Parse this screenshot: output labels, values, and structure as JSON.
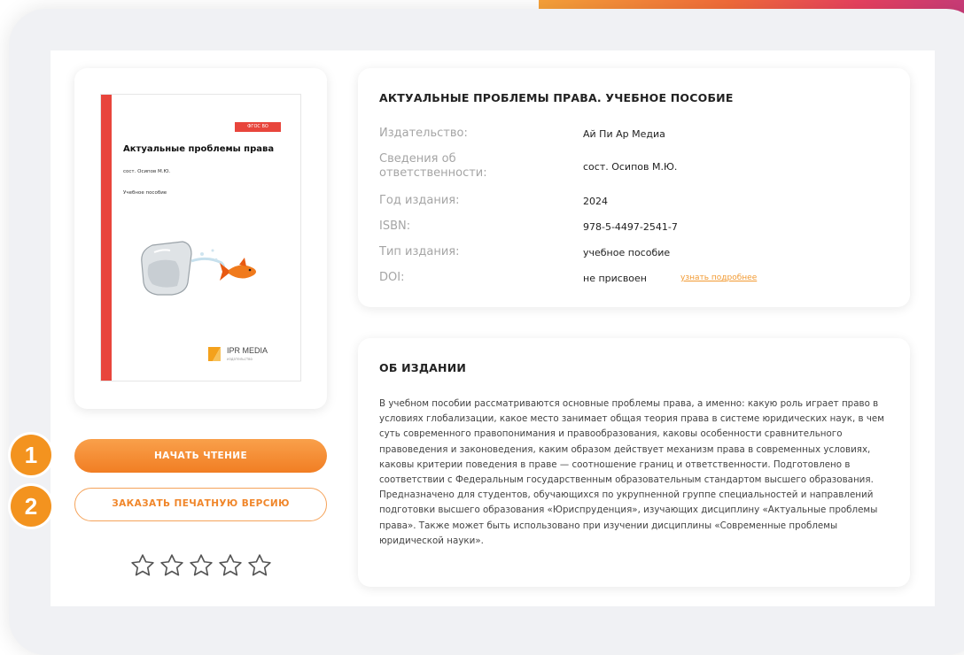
{
  "cover": {
    "badge": "ФГОС ВО",
    "title": "Актуальные проблемы права",
    "author": "сост. Осипов М.Ю.",
    "type": "Учебное пособие",
    "logo_text": "IPR MEDIA",
    "logo_sub": "издательство"
  },
  "buttons": {
    "start_reading": "НАЧАТЬ ЧТЕНИЕ",
    "order_print": "ЗАКАЗАТЬ ПЕЧАТНУЮ ВЕРСИЮ"
  },
  "markers": [
    "1",
    "2"
  ],
  "rating": {
    "stars": 5,
    "filled": 0
  },
  "info": {
    "title": "АКТУАЛЬНЫЕ ПРОБЛЕМЫ ПРАВА. УЧЕБНОЕ ПОСОБИЕ",
    "rows": [
      {
        "label": "Издательство:",
        "value": "Ай Пи Ар Медиа"
      },
      {
        "label": "Сведения об ответственности:",
        "value": "сост. Осипов М.Ю."
      },
      {
        "label": "Год издания:",
        "value": "2024"
      },
      {
        "label": "ISBN:",
        "value": "978-5-4497-2541-7"
      },
      {
        "label": "Тип издания:",
        "value": "учебное пособие"
      },
      {
        "label": "DOI:",
        "value": "не присвоен",
        "link": "узнать подробнее"
      }
    ]
  },
  "about": {
    "title": "ОБ ИЗДАНИИ",
    "text": "В учебном пособии рассматриваются основные проблемы права, а именно: какую роль играет право в условиях глобализации, какое место занимает общая теория права в системе юридических наук, в чем суть современного правопонимания и правообразования, каковы особенности сравнительного правоведения и законоведения, каким образом действует механизм права в современных условиях, каковы критерии поведения в праве — соотношение границ и ответственности. Подготовлено в соответствии с Федеральным государственным образовательным стандартом высшего образования. Предназначено для студентов, обучающихся по укрупненной группе специальностей и направлений подготовки высшего образования «Юриспруденция», изучающих дисциплину «Актуальные проблемы права». Также может быть использовано при изучении дисциплины «Современные проблемы юридической науки»."
  },
  "colors": {
    "accent": "#f17e23",
    "cover_red": "#e8453c",
    "frame": "#f0f1f4"
  }
}
